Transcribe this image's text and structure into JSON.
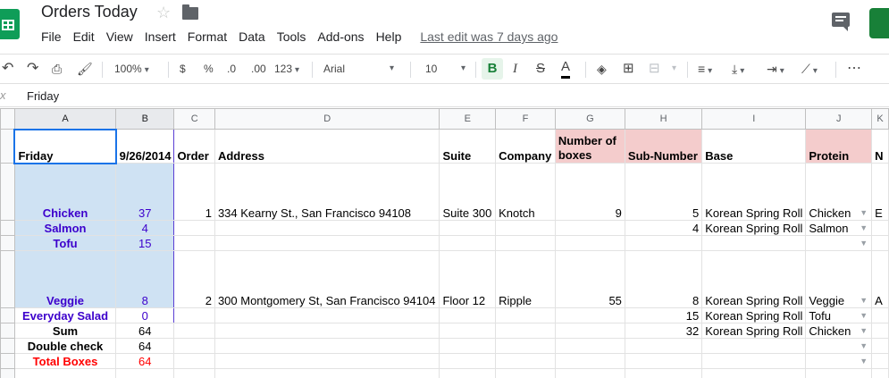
{
  "app": {
    "doc_title": "Orders Today",
    "menu": [
      "File",
      "Edit",
      "View",
      "Insert",
      "Format",
      "Data",
      "Tools",
      "Add-ons",
      "Help"
    ],
    "last_edit": "Last edit was 7 days ago",
    "brand_color": "#0f9d58"
  },
  "toolbar": {
    "zoom": "100%",
    "currency": "$",
    "percent": "%",
    "dec_decrease": ".0",
    "dec_increase": ".00",
    "more_formats": "123",
    "font": "Arial",
    "font_size": "10",
    "bold": "B",
    "italic": "I",
    "strike": "S",
    "text_color": "A",
    "more": "⋯"
  },
  "formula_bar": {
    "fx": "fx",
    "value": "Friday"
  },
  "sheet": {
    "columns": [
      "A",
      "B",
      "C",
      "D",
      "E",
      "F",
      "G",
      "H",
      "I",
      "J",
      "K"
    ],
    "header_row": {
      "a": "Friday",
      "b": "9/26/2014",
      "c": "Order",
      "d": "Address",
      "e": "Suite",
      "f": "Company",
      "g": "Number of boxes",
      "g1": "Number of",
      "g2": "boxes",
      "h": "Sub-Number",
      "i": "Base",
      "j": "Protein",
      "k": "N"
    },
    "summary": [
      {
        "label": "Chicken",
        "value": "37"
      },
      {
        "label": "Salmon",
        "value": "4"
      },
      {
        "label": "Tofu",
        "value": "15"
      },
      {
        "label": "Veggie",
        "value": "8"
      },
      {
        "label": "Everyday Salad",
        "value": "0"
      },
      {
        "label": "Sum",
        "value": "64"
      },
      {
        "label": "Double check",
        "value": "64"
      },
      {
        "label": "Total Boxes",
        "value": "64"
      }
    ],
    "orders": [
      {
        "order": "1",
        "address": "334 Kearny St., San Francisco 94108",
        "suite": "Suite 300",
        "company": "Knotch",
        "boxes": "9",
        "lines": [
          {
            "sub": "5",
            "base": "Korean Spring Roll",
            "protein": "Chicken",
            "k": "E"
          },
          {
            "sub": "4",
            "base": "Korean Spring Roll",
            "protein": "Salmon",
            "k": ""
          }
        ]
      },
      {
        "order": "2",
        "address": "300 Montgomery St, San Francisco 94104",
        "suite": "Floor 12",
        "company": "Ripple",
        "boxes": "55",
        "lines": [
          {
            "sub": "8",
            "base": "Korean Spring Roll",
            "protein": "Veggie",
            "k": "A"
          },
          {
            "sub": "15",
            "base": "Korean Spring Roll",
            "protein": "Tofu",
            "k": ""
          },
          {
            "sub": "32",
            "base": "Korean Spring Roll",
            "protein": "Chicken",
            "k": ""
          }
        ]
      }
    ],
    "colors": {
      "summary_fill": "#cfe2f3",
      "summary_text": "#3c00cc",
      "header_highlight": "#f4cccc",
      "total_text": "#ff0000"
    }
  }
}
